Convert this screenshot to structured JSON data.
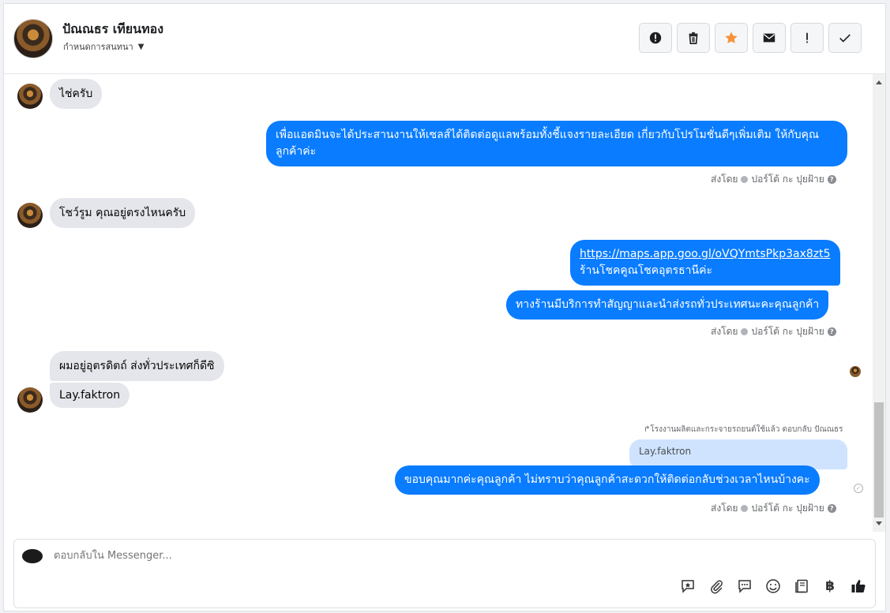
{
  "header": {
    "contact_name": "ปัณณธร เทียนทอง",
    "assign_label": "กำหนดการสนทนา",
    "actions": [
      "spam-icon",
      "trash-icon",
      "star-icon",
      "mail-icon",
      "important-icon",
      "done-icon"
    ]
  },
  "colors": {
    "outgoing": "#0a7cff",
    "incoming": "#e4e6eb",
    "star": "#f7923a"
  },
  "messages": {
    "m1": "ไช่ครับ",
    "m2": "เพื่อแอดมินจะได้ประสานงานให้เซลส์ได้ติดต่อดูแลพร้อมทั้งชี้แจงรายละเอียด เกี่ยวกับโปรโมชั่นดีๆเพิ่มเติม ให้กับคุณลูกค้าค่ะ",
    "m3": "โชว์รูม คุณอยู่ตรงไหนครับ",
    "m4_link": "https://maps.app.goo.gl/oVQYmtsPkp3ax8zt5",
    "m4_text": "ร้านโชคคูณโชคอุตรธานีค่ะ",
    "m5": "ทางร้านมีบริการทำสัญญาและนำส่งรถทั่วประเทศนะคะคุณลูกค้า",
    "m6": "ผมอยู่อุตรดิตถ์ ส่งทั่วประเทศก็ดีซิ",
    "m7": "Lay.faktron",
    "reply_note": "↱โรงงานผลิตและกระจายรถยนต์ใช้แล้ว ตอบกลับ ปัณณธร",
    "quoted": "Lay.faktron",
    "m8": "ขอบคุณมากค่ะคุณลูกค้า ไม่ทราบว่าคุณลูกค้าสะดวกให้ติดต่อกลับช่วงเวลาไหนบ้างคะ"
  },
  "sent_by": {
    "label": "ส่งโดย",
    "agent": "ปอร์โต้ กะ ปุยฝ้าย"
  },
  "composer": {
    "placeholder": "ตอบกลับใน Messenger...",
    "baht": "฿"
  }
}
